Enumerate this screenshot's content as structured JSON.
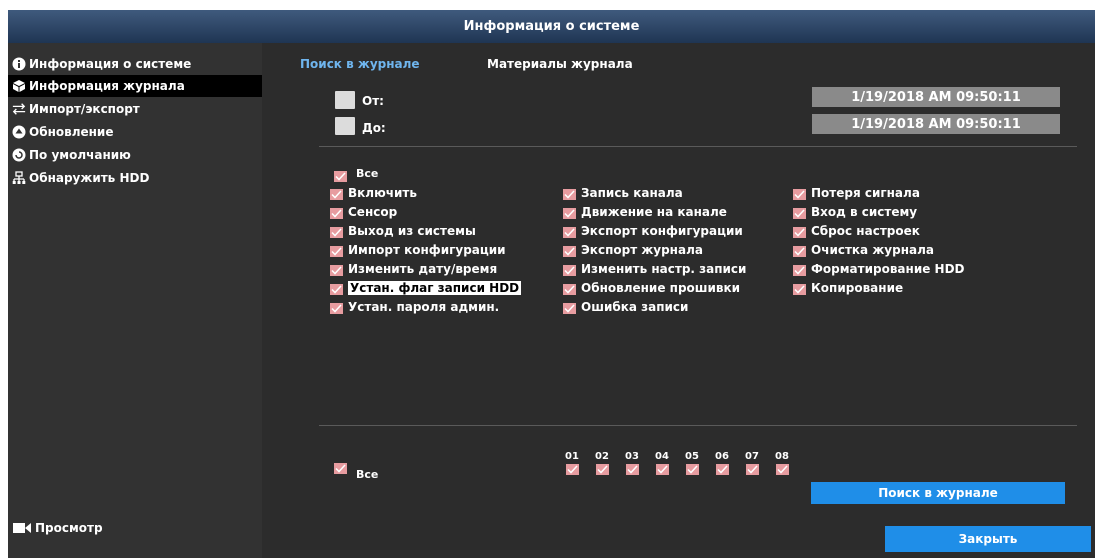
{
  "window": {
    "title": "Информация о системе"
  },
  "sidebar": {
    "items": [
      {
        "label": "Информация о системе",
        "icon": "info-icon"
      },
      {
        "label": "Информация журнала",
        "icon": "log-box-icon",
        "active": true
      },
      {
        "label": "Импорт/экспорт",
        "icon": "import-export-arrows-icon"
      },
      {
        "label": "Обновление",
        "icon": "upload-icon"
      },
      {
        "label": "По умолчанию",
        "icon": "reset-icon"
      },
      {
        "label": "Обнаружить HDD",
        "icon": "network-hdd-icon"
      }
    ],
    "preview_label": "Просмотр"
  },
  "tabs": [
    {
      "label": "Поиск в журнале",
      "active": true
    },
    {
      "label": "Материалы журнала",
      "active": false
    }
  ],
  "time_filter": {
    "from_label": "От:",
    "to_label": "До:",
    "from_value": "1/19/2018 AM 09:50:11",
    "to_value": "1/19/2018 AM 09:50:11"
  },
  "events": {
    "all_label": "Все",
    "col1": [
      "Включить",
      "Сенсор",
      "Выход из системы",
      "Импорт конфигурации",
      "Изменить дату/время",
      "Устан. флаг записи HDD",
      "Устан. пароля админ."
    ],
    "col2": [
      "Запись канала",
      "Движение на канале",
      "Экспорт конфигурации",
      "Экспорт журнала",
      "Изменить настр. записи",
      "Обновление прошивки",
      "Ошибка записи"
    ],
    "col3": [
      "Потеря сигнала",
      "Вход в систему",
      "Сброс настроек",
      "Очистка журнала",
      "Форматирование HDD",
      "Копирование"
    ]
  },
  "channels": {
    "all_label": "Все",
    "numbers": [
      "01",
      "02",
      "03",
      "04",
      "05",
      "06",
      "07",
      "08"
    ]
  },
  "buttons": {
    "search": "Поиск в журнале",
    "close": "Закрыть"
  },
  "colors": {
    "accent": "#1f8ee8",
    "checkbox_checked": "#e79ca0",
    "active_tab": "#6fb5ee"
  }
}
